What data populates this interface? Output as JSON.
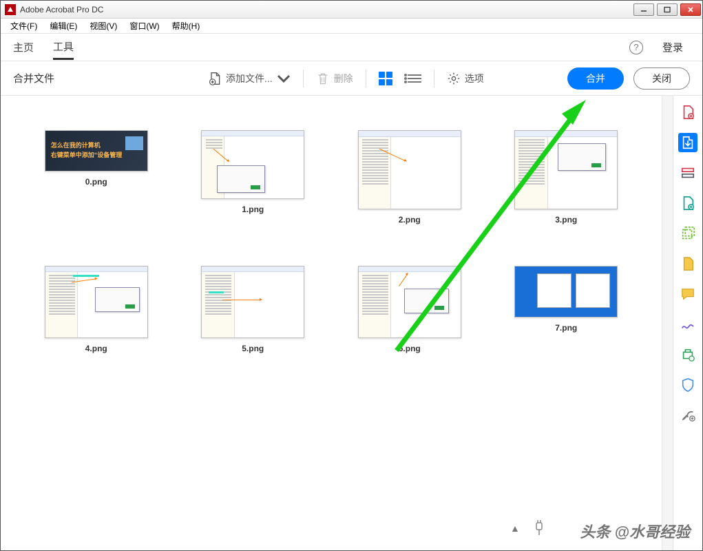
{
  "window": {
    "title": "Adobe Acrobat Pro DC"
  },
  "menu": {
    "file": "文件(F)",
    "edit": "编辑(E)",
    "view": "视图(V)",
    "window": "窗口(W)",
    "help": "帮助(H)"
  },
  "nav": {
    "home": "主页",
    "tools": "工具",
    "login": "登录"
  },
  "toolbar": {
    "title": "合并文件",
    "addFiles": "添加文件...",
    "delete": "删除",
    "options": "选项",
    "combine": "合并",
    "close": "关闭"
  },
  "files": [
    {
      "name": "0.png"
    },
    {
      "name": "1.png"
    },
    {
      "name": "2.png"
    },
    {
      "name": "3.png"
    },
    {
      "name": "4.png"
    },
    {
      "name": "5.png"
    },
    {
      "name": "6.png"
    },
    {
      "name": "7.png"
    }
  ],
  "thumb0_text": {
    "l1": "怎么在我的计算机",
    "l2": "右键菜单中添加“设备管理"
  },
  "watermark": "头条 @水哥经验",
  "colors": {
    "accent": "#027bff"
  }
}
